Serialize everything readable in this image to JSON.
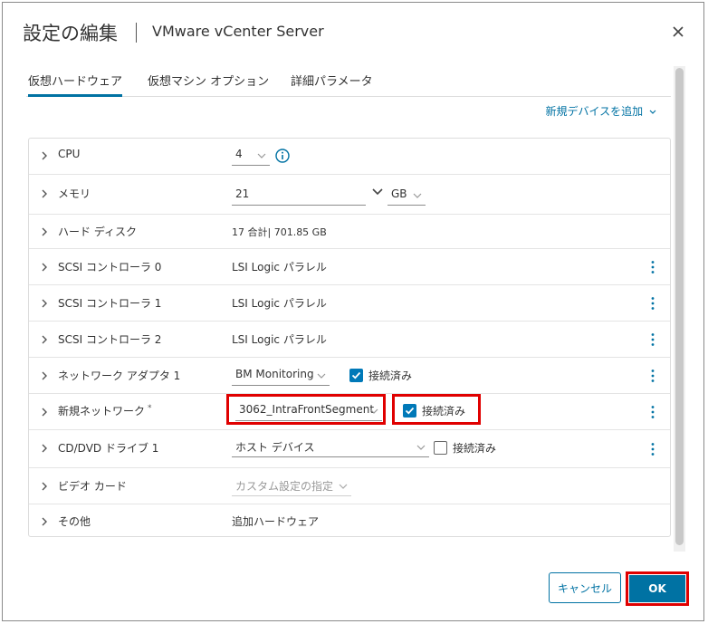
{
  "dialog": {
    "title": "設定の編集",
    "subtitle": "VMware vCenter Server"
  },
  "tabs": [
    {
      "label": "仮想ハードウェア",
      "active": true
    },
    {
      "label": "仮想マシン オプション",
      "active": false
    },
    {
      "label": "詳細パラメータ",
      "active": false
    }
  ],
  "add_device": "新規デバイスを追加",
  "rows": {
    "cpu": {
      "label": "CPU",
      "value": "4"
    },
    "memory": {
      "label": "メモリ",
      "value": "21",
      "unit": "GB"
    },
    "hdd": {
      "label": "ハード ディスク",
      "value": "17 合計| 701.85 GB"
    },
    "scsi0": {
      "label": "SCSI コントローラ 0",
      "value": "LSI Logic パラレル"
    },
    "scsi1": {
      "label": "SCSI コントローラ 1",
      "value": "LSI Logic パラレル"
    },
    "scsi2": {
      "label": "SCSI コントローラ 2",
      "value": "LSI Logic パラレル"
    },
    "netadapter1": {
      "label": "ネットワーク アダプタ 1",
      "value": "BM Monitoring",
      "connected_label": "接続済み",
      "connected": true
    },
    "newnet": {
      "label": "新規ネットワーク",
      "required_mark": "*",
      "value": "3062_IntraFrontSegment",
      "connected_label": "接続済み",
      "connected": true
    },
    "cddvd": {
      "label": "CD/DVD ドライブ 1",
      "value": "ホスト デバイス",
      "connected_label": "接続済み",
      "connected": false
    },
    "video": {
      "label": "ビデオ カード",
      "value": "カスタム設定の指定"
    },
    "other": {
      "label": "その他",
      "value": "追加ハードウェア"
    }
  },
  "buttons": {
    "cancel": "キャンセル",
    "ok": "OK"
  },
  "colors": {
    "accent": "#0072a3",
    "highlight": "#e00000"
  }
}
